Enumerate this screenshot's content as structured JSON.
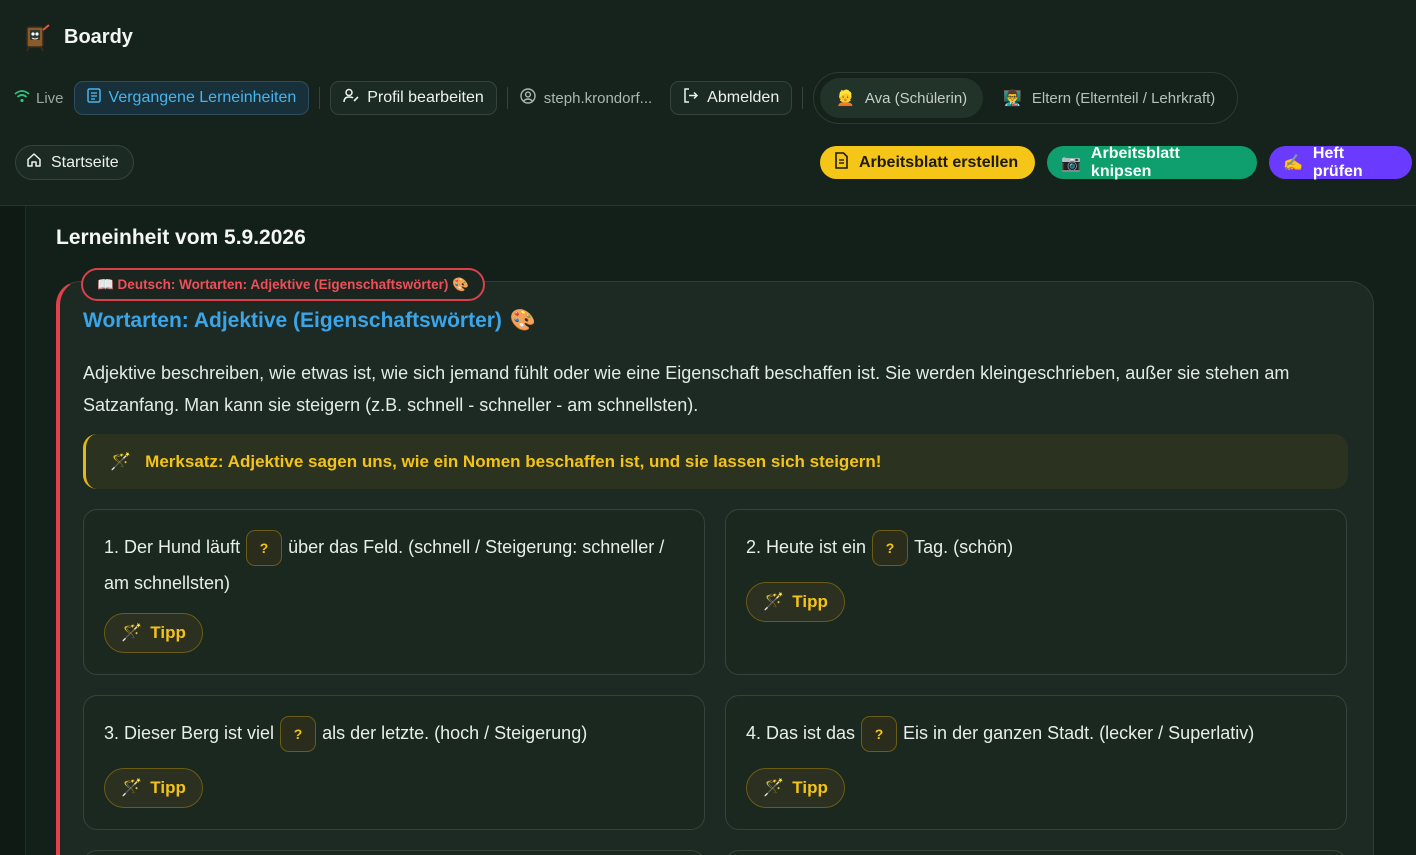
{
  "app": {
    "name": "Boardy"
  },
  "header": {
    "live_label": "Live",
    "past_units_label": "Vergangene Lerneinheiten",
    "edit_profile_label": "Profil bearbeiten",
    "user_email": "steph.krondorf...",
    "logout_label": "Abmelden",
    "roles": [
      {
        "emoji": "👱",
        "label": "Ava (Schülerin)",
        "active": true
      },
      {
        "emoji": "👨‍🏫",
        "label": "Eltern (Elternteil / Lehrkraft)",
        "active": false
      }
    ],
    "home_label": "Startseite",
    "actions": {
      "create_worksheet": {
        "emoji": "📄",
        "label": "Arbeitsblatt erstellen"
      },
      "snap_worksheet": {
        "emoji": "📷",
        "label": "Arbeitsblatt knipsen"
      },
      "check_notebook": {
        "emoji": "✍️",
        "label": "Heft prüfen"
      }
    }
  },
  "unit": {
    "title": "Lerneinheit vom 5.9.2026",
    "subject_tag": "📖 Deutsch: Wortarten: Adjektive (Eigenschaftswörter) 🎨",
    "card_title": "Wortarten: Adjektive (Eigenschaftswörter)",
    "card_title_emoji": "🎨",
    "description": "Adjektive beschreiben, wie etwas ist, wie sich jemand fühlt oder wie eine Eigenschaft beschaffen ist. Sie werden kleingeschrieben, außer sie stehen am Satzanfang. Man kann sie steigern (z.B. schnell - schneller - am schnellsten).",
    "merksatz_emoji": "🪄",
    "merksatz": "Merksatz: Adjektive sagen uns, wie ein Nomen beschaffen ist, und sie lassen sich steigern!",
    "blank_symbol": "?",
    "tip_emoji": "🪄",
    "tip_label": "Tipp",
    "exercises": [
      {
        "before": "1. Der Hund läuft",
        "after": "über das Feld. (schnell / Steigerung: schneller / am schnellsten)"
      },
      {
        "before": "2. Heute ist ein",
        "after": "Tag. (schön)"
      },
      {
        "before": "3. Dieser Berg ist viel",
        "after": "als der letzte. (hoch / Steigerung)"
      },
      {
        "before": "4. Das ist das",
        "after": "Eis in der ganzen Stadt. (lecker / Superlativ)"
      }
    ]
  },
  "colors": {
    "accent_blue": "#3ba5e9",
    "merksatz_yellow": "#f3c31a",
    "subject_red": "#ef4f59",
    "create_yellow": "#f5c518",
    "snap_green": "#0f9f6e",
    "check_purple": "#6a3bff"
  }
}
